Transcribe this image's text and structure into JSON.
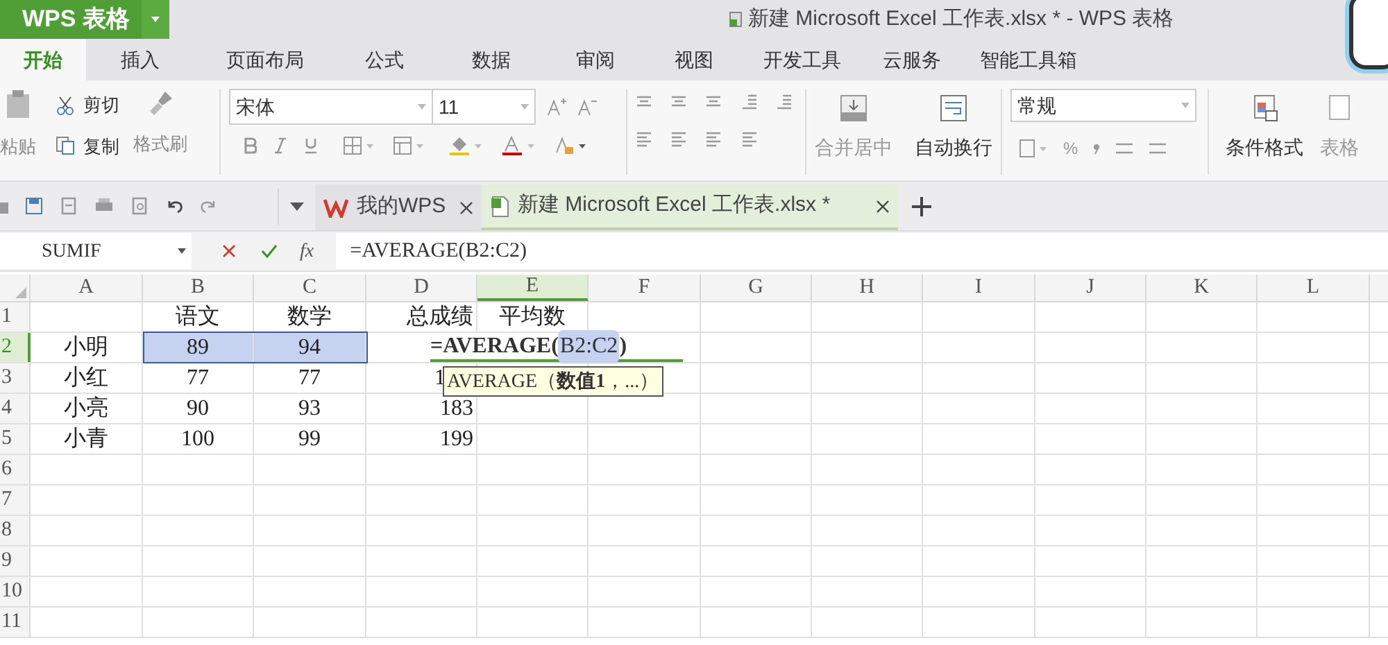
{
  "title_bar": {
    "app_button": "WPS 表格",
    "document_title": "新建 Microsoft Excel 工作表.xlsx * - WPS 表格"
  },
  "ribbon_tabs": [
    {
      "label": "开始",
      "selected": true
    },
    {
      "label": "插入",
      "selected": false
    },
    {
      "label": "页面布局",
      "selected": false
    },
    {
      "label": "公式",
      "selected": false
    },
    {
      "label": "数据",
      "selected": false
    },
    {
      "label": "审阅",
      "selected": false
    },
    {
      "label": "视图",
      "selected": false
    },
    {
      "label": "开发工具",
      "selected": false
    },
    {
      "label": "云服务",
      "selected": false
    },
    {
      "label": "智能工具箱",
      "selected": false
    }
  ],
  "ribbon": {
    "paste": "粘贴",
    "cut": "剪切",
    "copy": "复制",
    "format_painter": "格式刷",
    "font_name": "宋体",
    "font_size": "11",
    "merge_center": "合并居中",
    "wrap_text": "自动换行",
    "number_format": "常规",
    "percent": "%",
    "conditional_format": "条件格式",
    "table_style": "表格"
  },
  "document_tabs": [
    {
      "label": "我的WPS",
      "selected": false,
      "kind": "home"
    },
    {
      "label": "新建 Microsoft Excel 工作表.xlsx *",
      "selected": true,
      "kind": "sheet"
    }
  ],
  "formula_bar": {
    "name_box": "SUMIF",
    "fx": "fx",
    "formula": "=AVERAGE(B2:C2)"
  },
  "sheet": {
    "columns": [
      {
        "label": "A",
        "selected": false
      },
      {
        "label": "B",
        "selected": false
      },
      {
        "label": "C",
        "selected": false
      },
      {
        "label": "D",
        "selected": false
      },
      {
        "label": "E",
        "selected": true
      },
      {
        "label": "F",
        "selected": false
      },
      {
        "label": "G",
        "selected": false
      },
      {
        "label": "H",
        "selected": false
      },
      {
        "label": "I",
        "selected": false
      },
      {
        "label": "J",
        "selected": false
      },
      {
        "label": "K",
        "selected": false
      },
      {
        "label": "L",
        "selected": false
      }
    ],
    "rows": [
      {
        "header": "1",
        "selected": false,
        "cells": [
          null,
          {
            "text": "语文",
            "selected": false
          },
          {
            "text": "数学",
            "selected": false
          },
          {
            "text": "总成绩",
            "selected": false
          },
          {
            "text": "平均数",
            "selected": false
          }
        ]
      },
      {
        "header": "2",
        "selected": true,
        "cells": [
          {
            "text": "小明",
            "selected": false
          },
          {
            "text": "89",
            "selected": true
          },
          {
            "text": "94",
            "selected": true
          }
        ]
      },
      {
        "header": "3",
        "selected": false,
        "cells": [
          {
            "text": "小红",
            "selected": false
          },
          {
            "text": "77",
            "selected": false
          },
          {
            "text": "77",
            "selected": false
          },
          {
            "text": "1",
            "selected": false
          }
        ]
      },
      {
        "header": "4",
        "selected": false,
        "cells": [
          {
            "text": "小亮",
            "selected": false
          },
          {
            "text": "90",
            "selected": false
          },
          {
            "text": "93",
            "selected": false
          },
          {
            "text": "183",
            "selected": false
          }
        ]
      },
      {
        "header": "5",
        "selected": false,
        "cells": [
          {
            "text": "小青",
            "selected": false
          },
          {
            "text": "100",
            "selected": false
          },
          {
            "text": "99",
            "selected": false
          },
          {
            "text": "199",
            "selected": false
          }
        ]
      },
      {
        "header": "6",
        "selected": false,
        "cells": []
      },
      {
        "header": "7",
        "selected": false,
        "cells": []
      },
      {
        "header": "8",
        "selected": false,
        "cells": []
      },
      {
        "header": "9",
        "selected": false,
        "cells": []
      },
      {
        "header": "10",
        "selected": false,
        "cells": []
      },
      {
        "header": "11",
        "selected": false,
        "cells": []
      }
    ],
    "cell_editor": {
      "before": "=AVERAGE(",
      "reference": "B2:C2",
      "after": ")"
    },
    "tooltip": "AVERAGE（**数值1**，...）"
  }
}
